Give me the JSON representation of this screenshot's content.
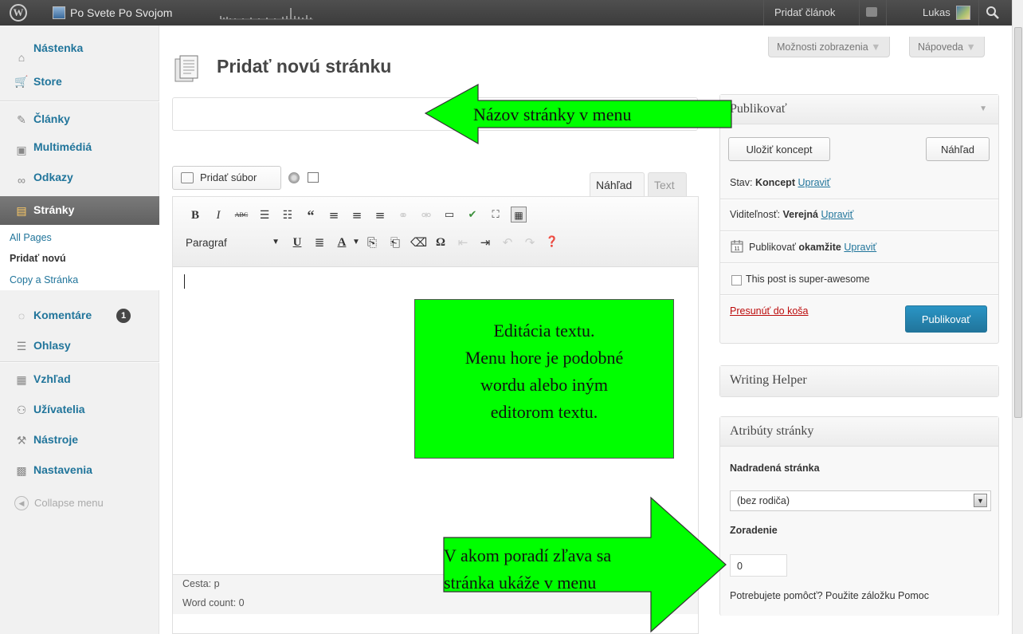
{
  "adminbar": {
    "site_name": "Po Svete Po Svojom",
    "add_post": "Pridať článok",
    "user": "Lukas"
  },
  "screen_meta": {
    "options": "Možnosti zobrazenia",
    "help": "Nápoveda"
  },
  "sidebar": {
    "items": [
      {
        "label": "Nástenka"
      },
      {
        "label": "Store"
      },
      {
        "label": "Články"
      },
      {
        "label": "Multimédiá"
      },
      {
        "label": "Odkazy"
      },
      {
        "label": "Stránky"
      },
      {
        "label": "Komentáre"
      },
      {
        "label": "Ohlasy"
      },
      {
        "label": "Vzhľad"
      },
      {
        "label": "Užívatelia"
      },
      {
        "label": "Nástroje"
      },
      {
        "label": "Nastavenia"
      }
    ],
    "submenu": [
      "All Pages",
      "Pridať novú",
      "Copy a Stránka"
    ],
    "comments_count": "1",
    "collapse": "Collapse menu"
  },
  "main": {
    "title": "Pridať novú stránku",
    "add_media": "Pridať súbor",
    "tab_visual": "Náhľad",
    "tab_text": "Text",
    "format": "Paragraf",
    "path": "Cesta: p",
    "word_count": "Word count: 0"
  },
  "publish": {
    "title": "Publikovať",
    "save_draft": "Uložiť koncept",
    "preview": "Náhľad",
    "status_label": "Stav:",
    "status_value": "Koncept",
    "edit": "Upraviť",
    "visibility_label": "Viditeľnosť:",
    "visibility_value": "Verejná",
    "publish_label": "Publikovať",
    "publish_value": "okamžite",
    "awesome": "This post is super-awesome",
    "trash": "Presunúť do koša",
    "publish_button": "Publikovať"
  },
  "writing_helper": {
    "title": "Writing Helper"
  },
  "attributes": {
    "title": "Atribúty stránky",
    "parent_label": "Nadradená stránka",
    "parent_value": "(bez rodiča)",
    "order_label": "Zoradenie",
    "order_value": "0",
    "help_text": "Potrebujete pomôcť? Použite záložku Pomoc"
  },
  "annotations": {
    "title_arrow": "Názov stránky v menu",
    "editor_box": [
      "Editácia textu.",
      "Menu hore je podobné",
      "wordu alebo iným",
      "editorom textu."
    ],
    "order_arrow": [
      "V akom poradí zľava sa",
      "stránka ukáže v menu"
    ]
  },
  "colors": {
    "annotation_green": "#00ff00",
    "admin_bar": "#464646",
    "link_blue": "#21759b",
    "primary_button": "#21759b",
    "trash_red": "#bc0b0b"
  }
}
